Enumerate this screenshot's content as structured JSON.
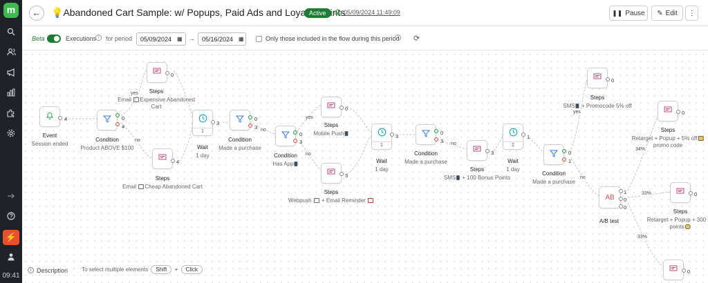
{
  "sidebar": {
    "logo": "m",
    "clock": "09:41"
  },
  "header": {
    "title": "Abandoned Cart Sample: w/ Popups, Paid Ads and Loyalty Points",
    "status": "Active",
    "saved": "05/09/2024 11:49:09",
    "pause": "Pause",
    "edit": "Edit",
    "more": "⋮"
  },
  "toolbar": {
    "beta": "Beta",
    "executions": "Executions",
    "for_period": "for period",
    "date_from": "05/09/2024",
    "arrow": "→",
    "date_to": "05/16/2024",
    "only_included": "Only those included in the flow during this period"
  },
  "nodes": {
    "event": {
      "title": "Event",
      "sub": "Session ended",
      "count": "4"
    },
    "cond1": {
      "title": "Condition",
      "sub": "Product ABOVE $100",
      "yes_count": "0",
      "no_count": "4"
    },
    "steps_expensive": {
      "title": "Steps",
      "sub": "Email",
      "sub2": "Expensive Abandoned",
      "sub3": "Cart",
      "count": "0"
    },
    "steps_cheap": {
      "title": "Steps",
      "sub": "Email",
      "sub2": "Cheap Abandoned Cart",
      "count": "4"
    },
    "wait1": {
      "title": "Wait",
      "sub": "1 day",
      "box": "1",
      "count": "3"
    },
    "cond2": {
      "title": "Condition",
      "sub": "Made a purchase",
      "yes_count": "0",
      "no_count": "3"
    },
    "cond3": {
      "title": "Condition",
      "sub": "Has App",
      "yes_count": "0",
      "no_count": "3"
    },
    "steps_push": {
      "title": "Steps",
      "sub": "Mobile Push",
      "count": "0"
    },
    "steps_webpush": {
      "title": "Steps",
      "sub": "Webpush",
      "sub2": "+ Email Reminder",
      "count": "3"
    },
    "wait2": {
      "title": "Wait",
      "sub": "1 day",
      "box": "1",
      "count": "3"
    },
    "cond4": {
      "title": "Condition",
      "sub": "Made a purchase",
      "yes_count": "0",
      "no_count": "3"
    },
    "steps_sms100": {
      "title": "Steps",
      "sub": "SMS",
      "sub2": "+ 100 Bonus Points",
      "count": "3"
    },
    "wait3": {
      "title": "Wait",
      "sub": "1 day",
      "box": "2",
      "count": "1"
    },
    "cond5": {
      "title": "Condition",
      "sub": "Made a purchase",
      "yes_count": "0",
      "no_count": "1"
    },
    "steps_promo": {
      "title": "Steps",
      "sub": "SMS",
      "sub2": "+ Promocode 5% off",
      "count": "0"
    },
    "ab": {
      "title": "A/B test",
      "icon": "AB",
      "c1": "1",
      "c2": "0",
      "c3": "0"
    },
    "steps_ret5": {
      "title": "Steps",
      "sub": "Retarget + Popup + 5% off",
      "sub2": "promo code",
      "count": "0"
    },
    "steps_ret300": {
      "title": "Steps",
      "sub": "Retarget + Popup + 300 bo",
      "sub2": "points",
      "count": "0"
    },
    "steps_last": {
      "count": "0"
    }
  },
  "edge_labels": {
    "yes": "yes",
    "no": "no",
    "pct1": "34%",
    "pct2": "33%",
    "pct3": "33%"
  },
  "footer": {
    "description": "Description",
    "hint": "To select multiple elements",
    "shift": "Shift",
    "plus": "+",
    "click": "Click"
  }
}
